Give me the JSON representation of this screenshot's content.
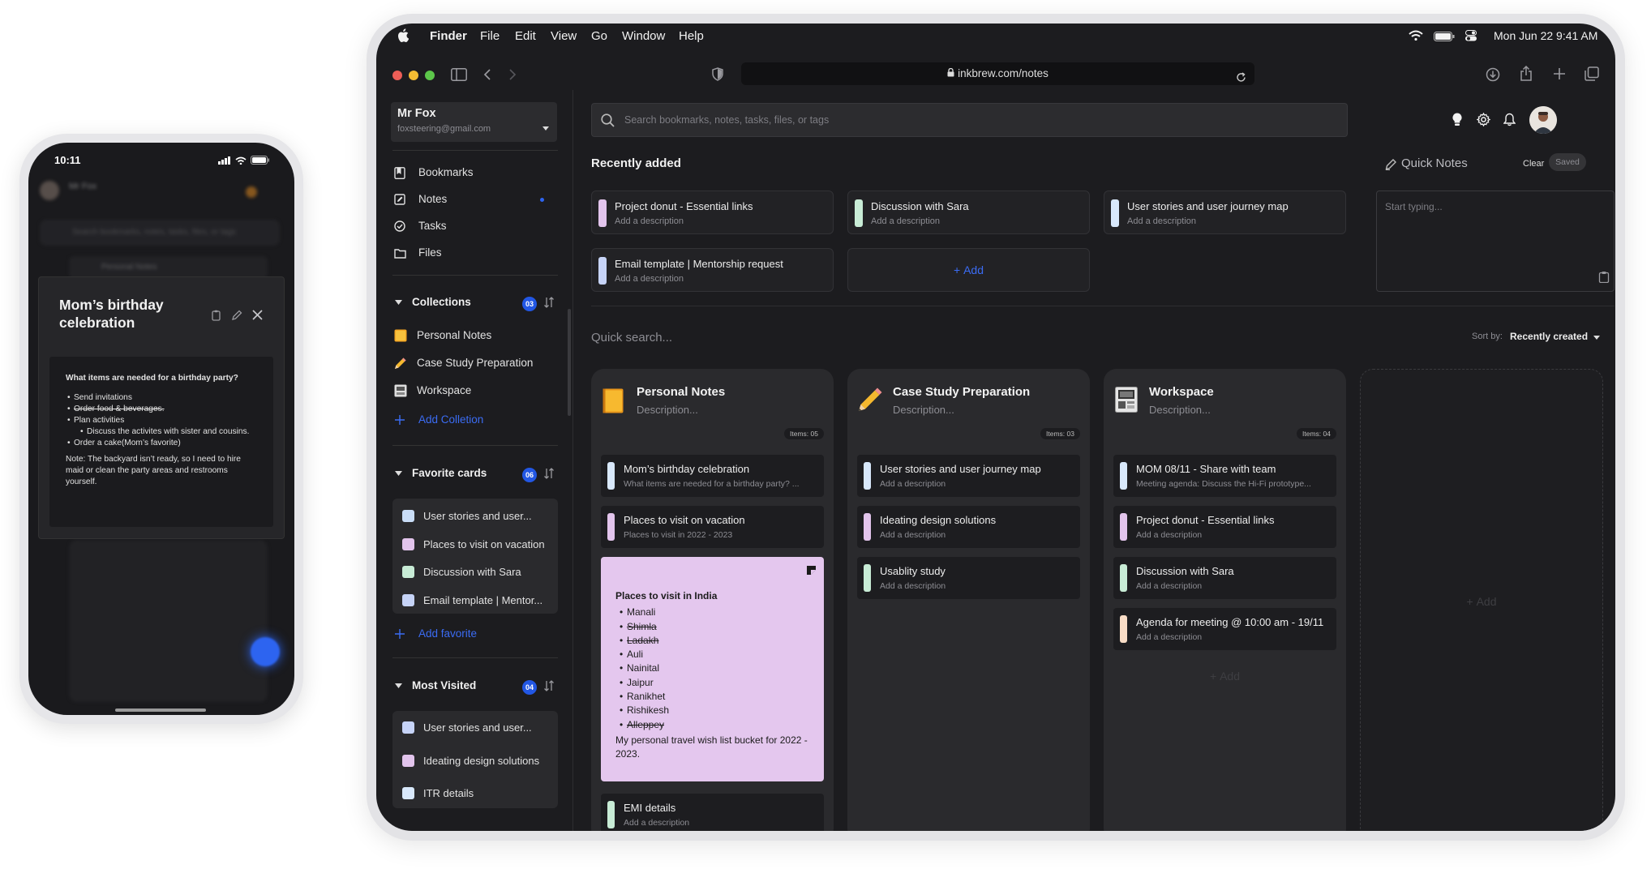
{
  "phone": {
    "time": "10:11",
    "modal_title": "Mom’s birthday celebration",
    "question": "What items are needed for a birthday party?",
    "list": [
      {
        "text": "Send invitations",
        "struck": false,
        "level": 1
      },
      {
        "text": "Order food & beverages.",
        "struck": true,
        "level": 1
      },
      {
        "text": "Plan activities",
        "struck": false,
        "level": 1
      },
      {
        "text": "Discuss the activites with sister and cousins.",
        "struck": false,
        "level": 2
      },
      {
        "text": "Order a cake(Mom’s favorite)",
        "struck": false,
        "level": 1
      }
    ],
    "note": "Note: The backyard isn’t ready, so I need to hire maid or clean the party areas and restrooms yourself.",
    "bg_user": "Mr Fox",
    "bg_search": "Search bookmarks, notes, tasks, files, or tags",
    "bg_card": "Personal Notes"
  },
  "menubar": {
    "app": "Finder",
    "menus": [
      "File",
      "Edit",
      "View",
      "Go",
      "Window",
      "Help"
    ],
    "datetime": "Mon Jun 22  9:41 AM"
  },
  "browser": {
    "url": "inkbrew.com/notes"
  },
  "user": {
    "name": "Mr Fox",
    "email": "foxsteering@gmail.com"
  },
  "nav": [
    {
      "label": "Bookmarks",
      "icon": "bookmark-icon"
    },
    {
      "label": "Notes",
      "icon": "note-icon"
    },
    {
      "label": "Tasks",
      "icon": "task-icon"
    },
    {
      "label": "Files",
      "icon": "folder-icon"
    }
  ],
  "collections": {
    "title": "Collections",
    "count": "03",
    "items": [
      {
        "label": "Personal Notes",
        "icon": "notebook-icon"
      },
      {
        "label": "Case Study Preparation",
        "icon": "pencil-icon"
      },
      {
        "label": "Workspace",
        "icon": "workspace-icon"
      }
    ],
    "add": "Add Colletion"
  },
  "favorites": {
    "title": "Favorite cards",
    "count": "06",
    "items": [
      {
        "label": "User stories and user...",
        "color": "#c9ddf7"
      },
      {
        "label": "Places to visit on vacation",
        "color": "#e2c4ec"
      },
      {
        "label": "Discussion with Sara",
        "color": "#c8ecd6"
      },
      {
        "label": "Email template | Mentor...",
        "color": "#c6d3f7"
      }
    ],
    "add": "Add favorite"
  },
  "most_visited": {
    "title": "Most Visited",
    "count": "04",
    "items": [
      {
        "label": "User stories and user...",
        "color": "#c6d3f7"
      },
      {
        "label": "Ideating design solutions",
        "color": "#e2c4ec"
      },
      {
        "label": "ITR details",
        "color": "#d8e8fb"
      }
    ]
  },
  "search": {
    "placeholder": "Search bookmarks, notes, tasks, files, or tags"
  },
  "recent": {
    "title": "Recently added",
    "cards": [
      {
        "title": "Project donut - Essential links",
        "desc": "Add a description",
        "color": "#e2c4ec"
      },
      {
        "title": "Discussion with Sara",
        "desc": "Add a description",
        "color": "#c8ecd6"
      },
      {
        "title": "User stories and user journey map",
        "desc": "Add a description",
        "color": "#d8e8fb"
      },
      {
        "title": "Email template | Mentorship request",
        "desc": "Add a description",
        "color": "#c6d3f7"
      }
    ],
    "add": "Add"
  },
  "quick_notes": {
    "title": "Quick Notes",
    "clear": "Clear",
    "saved": "Saved",
    "placeholder": "Start typing..."
  },
  "quick_search": {
    "placeholder": "Quick search...",
    "sort_label": "Sort by:",
    "sort_value": "Recently created"
  },
  "columns": [
    {
      "title": "Personal Notes",
      "desc": "Description...",
      "items_label": "Items: 05",
      "icon": "notebook-icon",
      "cards": [
        {
          "title": "Mom’s birthday celebration",
          "desc": "What items are needed for a birthday party? ...",
          "color": "#d8e8fb"
        },
        {
          "title": "Places to visit on vacation",
          "desc": "Places to visit in 2022 - 2023",
          "color": "#e2c4ec"
        }
      ],
      "sticky": {
        "heading": "Places to visit in India",
        "items": [
          {
            "text": "Manali",
            "struck": false
          },
          {
            "text": "Shimla",
            "struck": true
          },
          {
            "text": "Ladakh",
            "struck": true
          },
          {
            "text": "Auli",
            "struck": false
          },
          {
            "text": "Nainital",
            "struck": false
          },
          {
            "text": "Jaipur",
            "struck": false
          },
          {
            "text": "Ranikhet",
            "struck": false
          },
          {
            "text": "Rishikesh",
            "struck": false
          },
          {
            "text": "Alleppey",
            "struck": true
          }
        ],
        "footer": "My personal travel wish list bucket for 2022 - 2023.",
        "color": "#e4c7ee"
      },
      "last_card": {
        "title": "EMI details",
        "desc": "Add a description",
        "color": "#c8ecd6"
      }
    },
    {
      "title": "Case Study Preparation",
      "desc": "Description...",
      "items_label": "Items: 03",
      "icon": "pencil-icon",
      "cards": [
        {
          "title": "User stories and user journey map",
          "desc": "Add a description",
          "color": "#d8e8fb"
        },
        {
          "title": "Ideating design solutions",
          "desc": "Add a description",
          "color": "#e2c4ec"
        },
        {
          "title": "Usablity study",
          "desc": "Add a description",
          "color": "#c8ecd6"
        }
      ]
    },
    {
      "title": "Workspace",
      "desc": "Description...",
      "items_label": "Items: 04",
      "icon": "workspace-icon",
      "cards": [
        {
          "title": "MOM 08/11 - Share with team",
          "desc": "Meeting agenda: Discuss the Hi-Fi prototype...",
          "color": "#d8e8fb"
        },
        {
          "title": "Project donut - Essential links",
          "desc": "Add a description",
          "color": "#e2c4ec"
        },
        {
          "title": "Discussion with Sara",
          "desc": "Add a description",
          "color": "#c8ecd6"
        },
        {
          "title": "Agenda for meeting @ 10:00 am - 19/11",
          "desc": "Add a description",
          "color": "#f8dcc6"
        }
      ],
      "add": "Add"
    }
  ],
  "empty_column_add": "Add"
}
